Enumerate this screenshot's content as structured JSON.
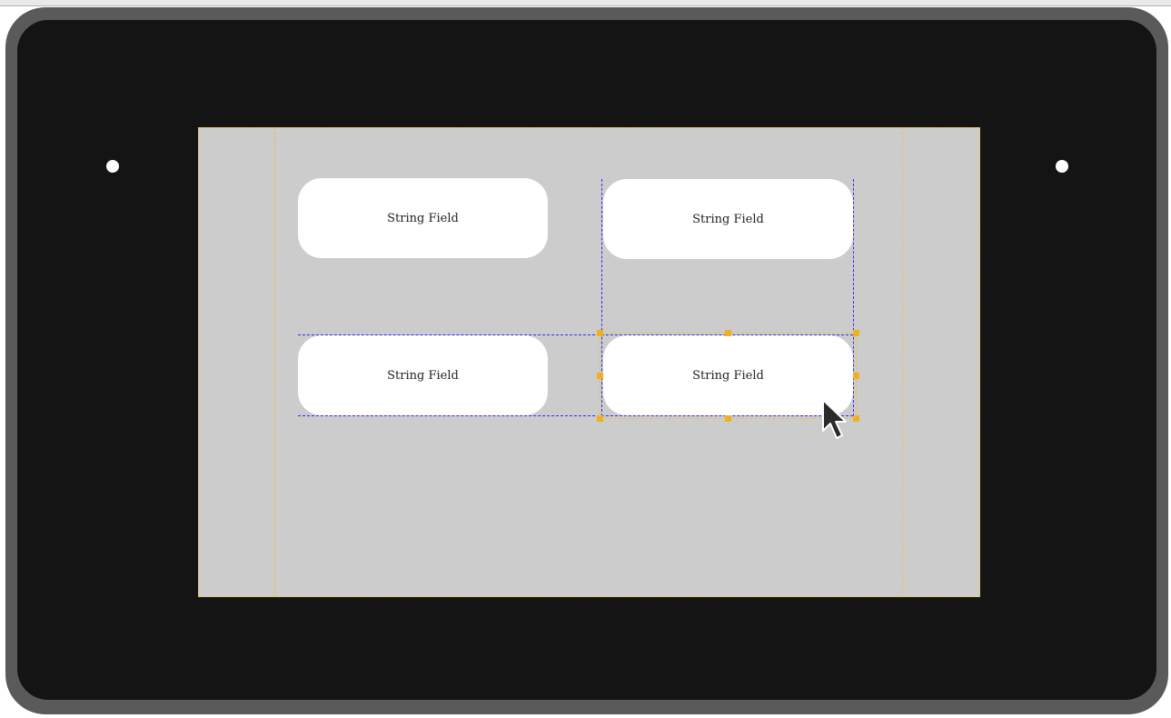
{
  "colors": {
    "bezel": "#5a5a5a",
    "device_face": "#141414",
    "screen_background": "#cccccc",
    "field_background": "#ffffff",
    "guide_dashed": "#e9c249",
    "alignment_guide": "#2b2bff",
    "selection_handle": "#f0b020"
  },
  "screen": {
    "fields": [
      {
        "label": "String Field"
      },
      {
        "label": "String Field"
      },
      {
        "label": "String Field"
      },
      {
        "label": "String Field",
        "selected": true
      }
    ]
  },
  "icons": {
    "cursor": "mouse-pointer-icon",
    "camera": "camera-dot-icon"
  }
}
